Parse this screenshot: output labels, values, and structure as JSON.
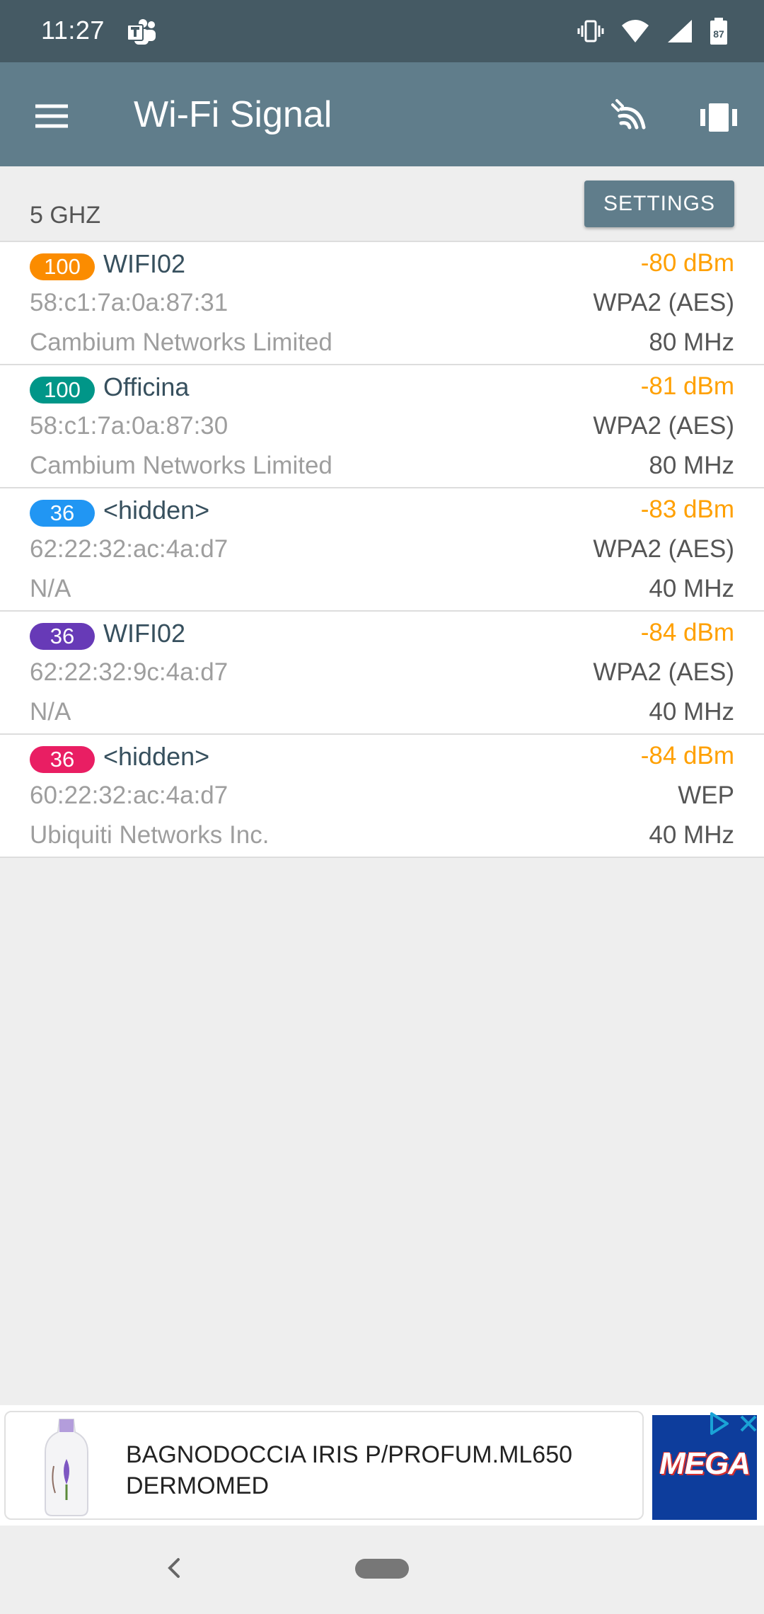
{
  "status_bar": {
    "time": "11:27",
    "battery": "87",
    "icons": [
      "teams-icon",
      "vibrate-icon",
      "wifi-icon",
      "cell-signal-icon",
      "battery-icon"
    ]
  },
  "app_bar": {
    "title": "Wi-Fi Signal",
    "icons": [
      "menu-icon",
      "scan-icon",
      "vibrate-toggle-icon"
    ]
  },
  "band": {
    "label": "5 GHZ",
    "settings_label": "SETTINGS"
  },
  "networks": [
    {
      "channel": "100",
      "badge_color": "#fb8c00",
      "ssid": "WIFI02",
      "bssid": "58:c1:7a:0a:87:31",
      "vendor": "Cambium Networks Limited",
      "signal": "-80 dBm",
      "security": "WPA2 (AES)",
      "width": "80 MHz"
    },
    {
      "channel": "100",
      "badge_color": "#009688",
      "ssid": "Officina",
      "bssid": "58:c1:7a:0a:87:30",
      "vendor": "Cambium Networks Limited",
      "signal": "-81 dBm",
      "security": "WPA2 (AES)",
      "width": "80 MHz"
    },
    {
      "channel": "36",
      "badge_color": "#2196f3",
      "ssid": "<hidden>",
      "bssid": "62:22:32:ac:4a:d7",
      "vendor": "N/A",
      "signal": "-83 dBm",
      "security": "WPA2 (AES)",
      "width": "40 MHz"
    },
    {
      "channel": "36",
      "badge_color": "#673ab7",
      "ssid": "WIFI02",
      "bssid": "62:22:32:9c:4a:d7",
      "vendor": "N/A",
      "signal": "-84 dBm",
      "security": "WPA2 (AES)",
      "width": "40 MHz"
    },
    {
      "channel": "36",
      "badge_color": "#e91e63",
      "ssid": "<hidden>",
      "bssid": "60:22:32:ac:4a:d7",
      "vendor": "Ubiquiti Networks Inc.",
      "signal": "-84 dBm",
      "security": "WEP",
      "width": "40 MHz"
    }
  ],
  "ad": {
    "line1": "BAGNODOCCIA IRIS P/PROFUM.ML650",
    "line2": "DERMOMED",
    "logo_text": "MEGA",
    "icons": [
      "ad-choices-icon",
      "close-icon"
    ]
  },
  "nav_bar": {
    "icons": [
      "back-icon",
      "home-pill-icon"
    ]
  },
  "colors": {
    "status_bar": "#455a64",
    "app_bar": "#607d8b",
    "signal_text": "#ffa000",
    "ssid_text": "#37505e",
    "secondary_text": "#9e9e9e",
    "background": "#eeeeee"
  }
}
